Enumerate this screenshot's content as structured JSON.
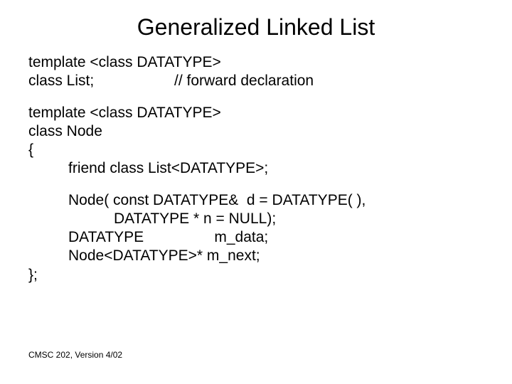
{
  "title": "Generalized Linked List",
  "block1": {
    "line1": "template <class DATATYPE>",
    "line2_left": "class List;",
    "line2_right": "// forward declaration"
  },
  "block2": {
    "line1": "template <class DATATYPE>",
    "line2": "class Node",
    "line3": "{",
    "line4": "friend class List<DATATYPE>;"
  },
  "block3": {
    "line1": "Node( const DATATYPE&  d = DATATYPE( ),",
    "line2": "DATATYPE * n = NULL);",
    "line3": "DATATYPE                 m_data;",
    "line4": "Node<DATATYPE>* m_next;",
    "close": "};"
  },
  "footer": "CMSC 202, Version 4/02"
}
